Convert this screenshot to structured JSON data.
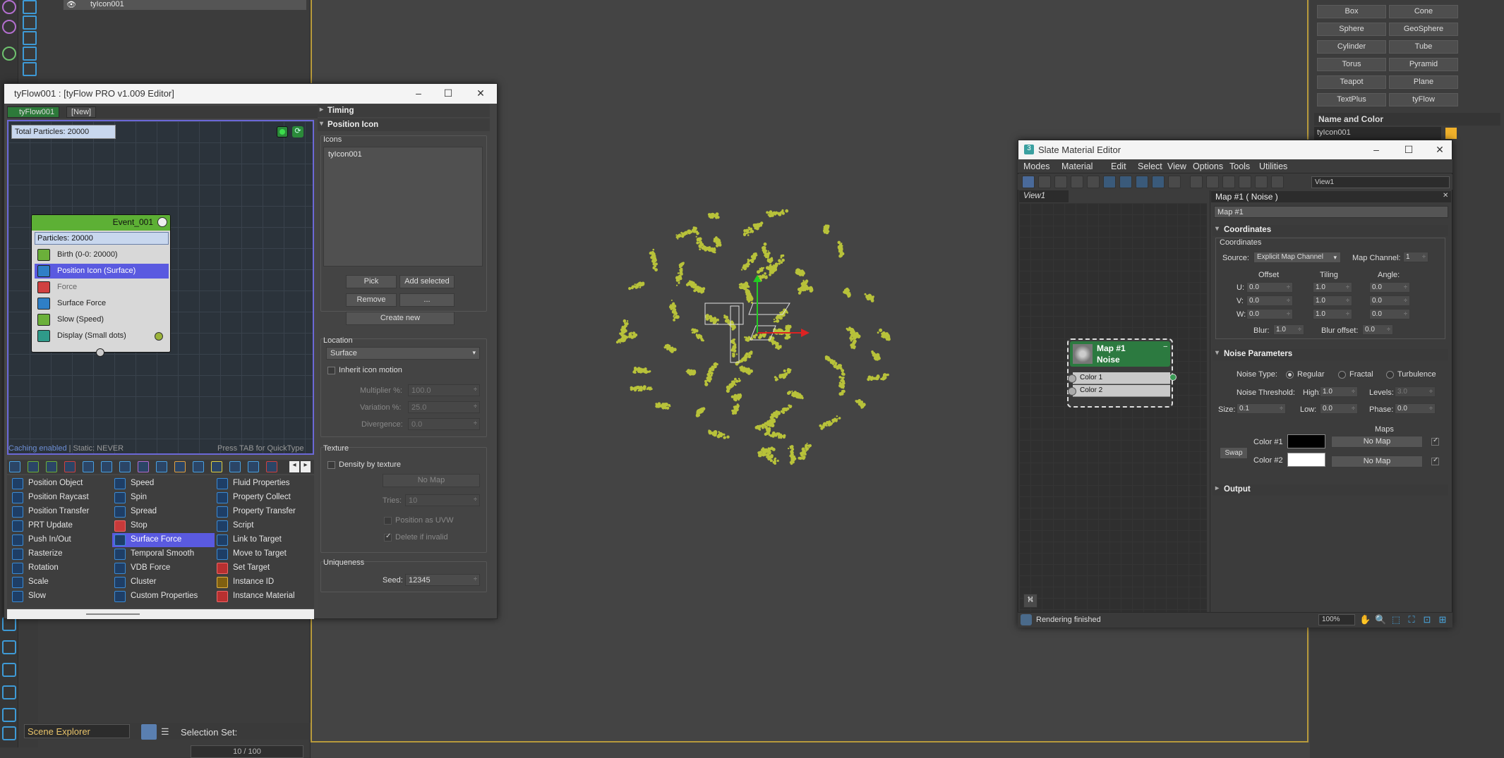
{
  "scene_panel": {
    "selected_row": "tyIcon001",
    "explorer_label": "Scene Explorer",
    "selection_set_label": "Selection Set:",
    "frame_counter": "10 / 100"
  },
  "create_panel": {
    "objects": [
      "Box",
      "Cone",
      "Sphere",
      "GeoSphere",
      "Cylinder",
      "Tube",
      "Torus",
      "Pyramid",
      "Teapot",
      "Plane",
      "TextPlus",
      "tyFlow"
    ],
    "name_and_color_label": "Name and Color",
    "name_value": "tyIcon001",
    "object_color": "#f0b12b"
  },
  "tyflow_editor": {
    "title": "tyFlow001 : [tyFlow PRO v1.009 Editor]",
    "tabs": [
      "tyFlow001",
      "[New]"
    ],
    "total_particles": "Total Particles: 20000",
    "event": {
      "name": "Event_001",
      "particles": "Particles: 20000",
      "operators": [
        {
          "label": "Birth (0-0: 20000)",
          "state": "normal",
          "color": "#6bb03a"
        },
        {
          "label": "Position Icon (Surface)",
          "state": "selected",
          "color": "#2f7fc6"
        },
        {
          "label": "Force",
          "state": "disabled",
          "color": "#d04040"
        },
        {
          "label": "Surface Force",
          "state": "normal",
          "color": "#2f7fc6"
        },
        {
          "label": "Slow (Speed)",
          "state": "normal",
          "color": "#6bb03a"
        },
        {
          "label": "Display (Small dots)",
          "state": "normal",
          "color": "#2f9a8a"
        }
      ]
    },
    "status_caching": "Caching enabled",
    "status_static": " | Static: NEVER",
    "hint": "Press TAB for QuickType",
    "operator_columns": [
      [
        "Position Object",
        "Position Raycast",
        "Position Transfer",
        "PRT Update",
        "Push In/Out",
        "Rasterize",
        "Rotation",
        "Scale",
        "Slow"
      ],
      [
        "Speed",
        "Spin",
        "Spread",
        "Stop",
        "Surface Force",
        "Temporal Smooth",
        "VDB Force",
        "Cluster",
        "Custom Properties"
      ],
      [
        "Fluid Properties",
        "Property Collect",
        "Property Transfer",
        "Script",
        "Link to Target",
        "Move to Target",
        "Set Target",
        "Instance ID",
        "Instance Material"
      ]
    ],
    "selected_operator": "Surface Force",
    "rollouts": {
      "timing": "Timing",
      "position_icon": "Position Icon",
      "icons_label": "Icons",
      "icons_list": [
        "tyIcon001"
      ],
      "pick": "Pick",
      "add_selected": "Add selected",
      "remove": "Remove",
      "more": "...",
      "create_new": "Create new",
      "location_label": "Location",
      "location_value": "Surface",
      "inherit_icon_motion": "Inherit icon motion",
      "multiplier_label": "Multiplier %:",
      "multiplier_value": "100.0",
      "variation_label": "Variation %:",
      "variation_value": "25.0",
      "divergence_label": "Divergence:",
      "divergence_value": "0.0",
      "texture_label": "Texture",
      "density_by_texture": "Density by texture",
      "no_map": "No Map",
      "tries_label": "Tries:",
      "tries_value": "10",
      "position_as_uvw": "Position as UVW",
      "delete_if_invalid": "Delete if invalid",
      "uniqueness_label": "Uniqueness",
      "seed_label": "Seed:",
      "seed_value": "12345"
    }
  },
  "slate_editor": {
    "title": "Slate Material Editor",
    "menu": [
      "Modes",
      "Material",
      "Edit",
      "Select",
      "View",
      "Options",
      "Tools",
      "Utilities"
    ],
    "view_dropdown": "View1",
    "view_tab": "View1",
    "node": {
      "title1": "Map #1",
      "title2": "Noise",
      "slot1": "Color 1",
      "slot2": "Color 2"
    },
    "params_title": "Map #1  ( Noise )",
    "map_name": "Map #1",
    "coordinates": {
      "header": "Coordinates",
      "sub": "Coordinates",
      "source_label": "Source:",
      "source_value": "Explicit Map Channel",
      "map_channel_label": "Map Channel:",
      "map_channel_value": "1",
      "offset_label": "Offset",
      "tiling_label": "Tiling",
      "angle_label": "Angle:",
      "u": "U:",
      "v": "V:",
      "w": "W:",
      "offset": [
        "0.0",
        "0.0",
        "0.0"
      ],
      "tiling": [
        "1.0",
        "1.0",
        "1.0"
      ],
      "angle": [
        "0.0",
        "0.0",
        "0.0"
      ],
      "blur_label": "Blur:",
      "blur_value": "1.0",
      "blur_offset_label": "Blur offset:",
      "blur_offset_value": "0.0"
    },
    "noise": {
      "header": "Noise Parameters",
      "type_label": "Noise Type:",
      "types": [
        "Regular",
        "Fractal",
        "Turbulence"
      ],
      "selected_type": "Regular",
      "threshold_label": "Noise Threshold:",
      "high_label": "High:",
      "high_value": "1.0",
      "levels_label": "Levels:",
      "levels_value": "3.0",
      "size_label": "Size:",
      "size_value": "0.1",
      "low_label": "Low:",
      "low_value": "0.0",
      "phase_label": "Phase:",
      "phase_value": "0.0",
      "maps_label": "Maps",
      "swap": "Swap",
      "color1_label": "Color #1",
      "color1": "#000000",
      "color2_label": "Color #2",
      "color2": "#ffffff",
      "no_map": "No Map"
    },
    "output_header": "Output",
    "status": "Rendering finished",
    "zoom": "100%"
  }
}
